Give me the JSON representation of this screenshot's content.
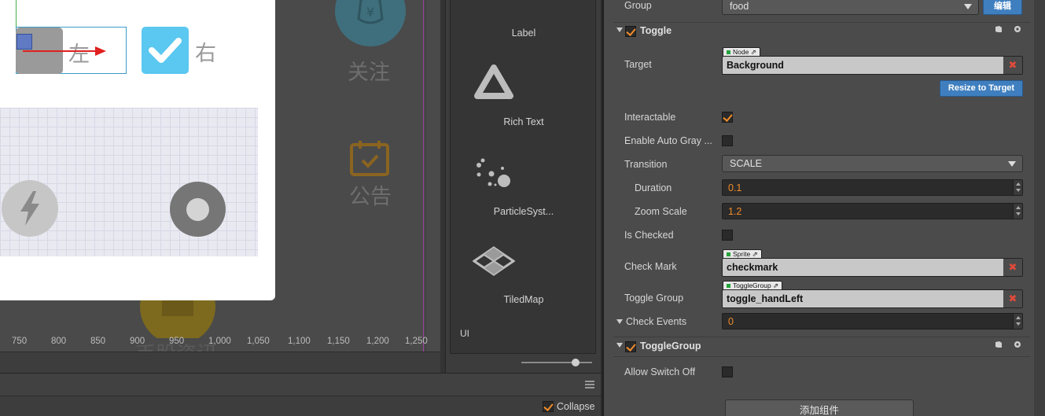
{
  "scene": {
    "toggle_left_label": "左",
    "toggle_right_label": "右",
    "bg_icon_follow_label": "关注",
    "bg_icon_notice_label": "公告",
    "bg_icon_bottom_label": "币股资讯",
    "ruler_ticks": [
      "750",
      "800",
      "850",
      "900",
      "950",
      "1,000",
      "1,050",
      "1,100",
      "1,150",
      "1,200",
      "1,250"
    ]
  },
  "library": {
    "items": [
      {
        "label": "Label",
        "icon": "label-icon"
      },
      {
        "label": "Rich Text",
        "icon": "rich-text-icon"
      },
      {
        "label": "ParticleSyst...",
        "icon": "particle-system-icon"
      },
      {
        "label": "TiledMap",
        "icon": "tiledmap-icon"
      }
    ],
    "category_label": "UI"
  },
  "console": {
    "collapse_label": "Collapse",
    "collapse_checked": true
  },
  "inspector": {
    "group": {
      "label": "Group",
      "value": "food",
      "edit_button": "编辑"
    },
    "toggle_section": {
      "title": "Toggle",
      "enabled": true
    },
    "target": {
      "label": "Target",
      "type_tag": "Node",
      "value": "Background"
    },
    "resize_button": "Resize to Target",
    "interactable": {
      "label": "Interactable",
      "checked": true
    },
    "enable_auto_gray": {
      "label": "Enable Auto Gray ...",
      "checked": false
    },
    "transition": {
      "label": "Transition",
      "value": "SCALE"
    },
    "duration": {
      "label": "Duration",
      "value": "0.1"
    },
    "zoom_scale": {
      "label": "Zoom Scale",
      "value": "1.2"
    },
    "is_checked": {
      "label": "Is Checked",
      "checked": false
    },
    "check_mark": {
      "label": "Check Mark",
      "type_tag": "Sprite",
      "value": "checkmark"
    },
    "toggle_group": {
      "label": "Toggle Group",
      "type_tag": "ToggleGroup",
      "value": "toggle_handLeft"
    },
    "check_events": {
      "label": "Check Events",
      "value": "0"
    },
    "toggle_group_section": {
      "title": "ToggleGroup",
      "enabled": true
    },
    "allow_switch_off": {
      "label": "Allow Switch Off",
      "checked": false
    },
    "add_component_button": "添加组件"
  },
  "colors": {
    "accent_orange": "#f08c2a",
    "button_blue": "#3f7fbf",
    "toggle_checked_blue": "#5ac8f0",
    "remove_red": "#e04a3a"
  }
}
